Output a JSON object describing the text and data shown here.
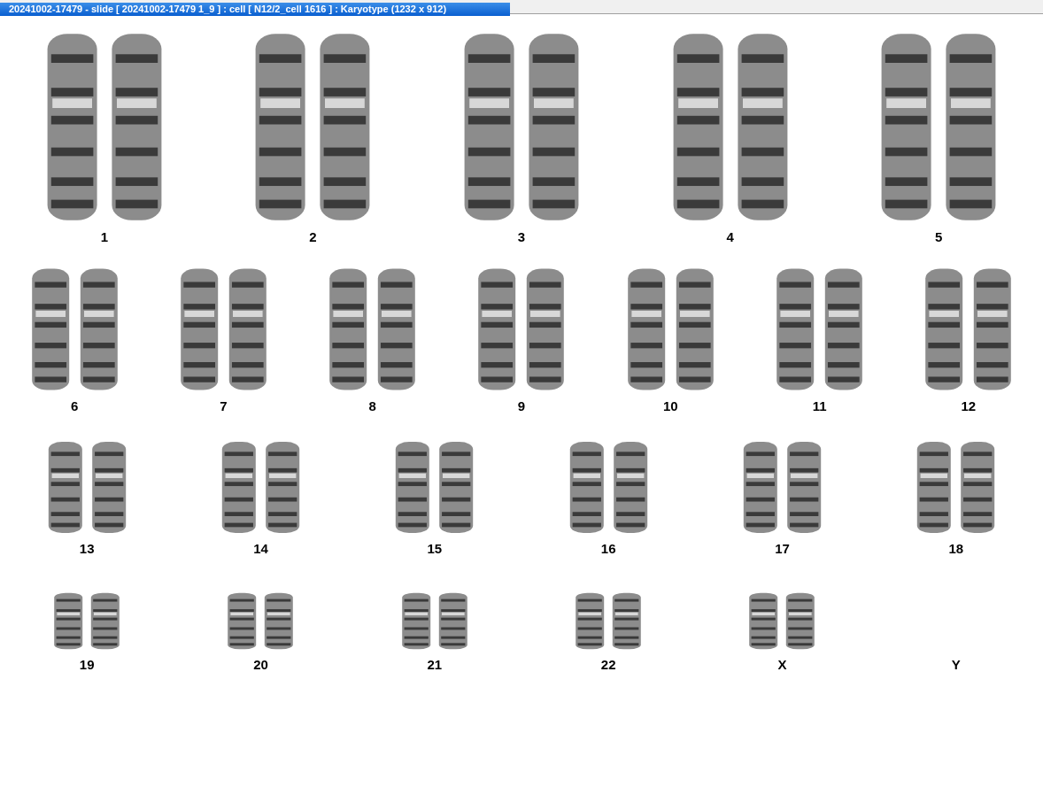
{
  "window": {
    "title": "20241002-17479 - slide [ 20241002-17479 1_9 ] : cell [ N12/2_cell 1616 ] : Karyotype  (1232 x 912)"
  },
  "karyotype": {
    "rows": [
      [
        {
          "label": "1"
        },
        {
          "label": "2"
        },
        {
          "label": "3"
        },
        {
          "label": "4"
        },
        {
          "label": "5"
        }
      ],
      [
        {
          "label": "6"
        },
        {
          "label": "7"
        },
        {
          "label": "8"
        },
        {
          "label": "9"
        },
        {
          "label": "10"
        },
        {
          "label": "11"
        },
        {
          "label": "12"
        }
      ],
      [
        {
          "label": "13"
        },
        {
          "label": "14"
        },
        {
          "label": "15"
        },
        {
          "label": "16"
        },
        {
          "label": "17"
        },
        {
          "label": "18"
        }
      ],
      [
        {
          "label": "19"
        },
        {
          "label": "20"
        },
        {
          "label": "21"
        },
        {
          "label": "22"
        },
        {
          "label": "X"
        },
        {
          "label": "Y"
        }
      ]
    ]
  }
}
